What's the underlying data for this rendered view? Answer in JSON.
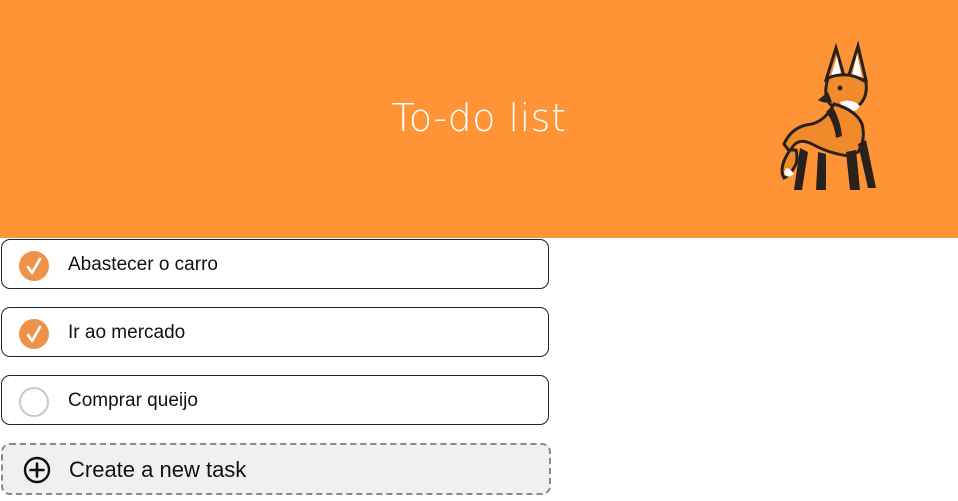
{
  "header": {
    "title": "To-do list",
    "background_color": "#ff9436",
    "mascot_icon": "maned-wolf-icon"
  },
  "tasks": [
    {
      "label": "Abastecer o carro",
      "completed": true
    },
    {
      "label": "Ir ao mercado",
      "completed": true
    },
    {
      "label": "Comprar queijo",
      "completed": false
    }
  ],
  "new_task": {
    "label": "Create a new task",
    "icon": "plus-circle-icon"
  },
  "colors": {
    "accent": "#ee9249",
    "unchecked_border": "#c8c8c8",
    "new_task_background": "#f0f0f0"
  }
}
